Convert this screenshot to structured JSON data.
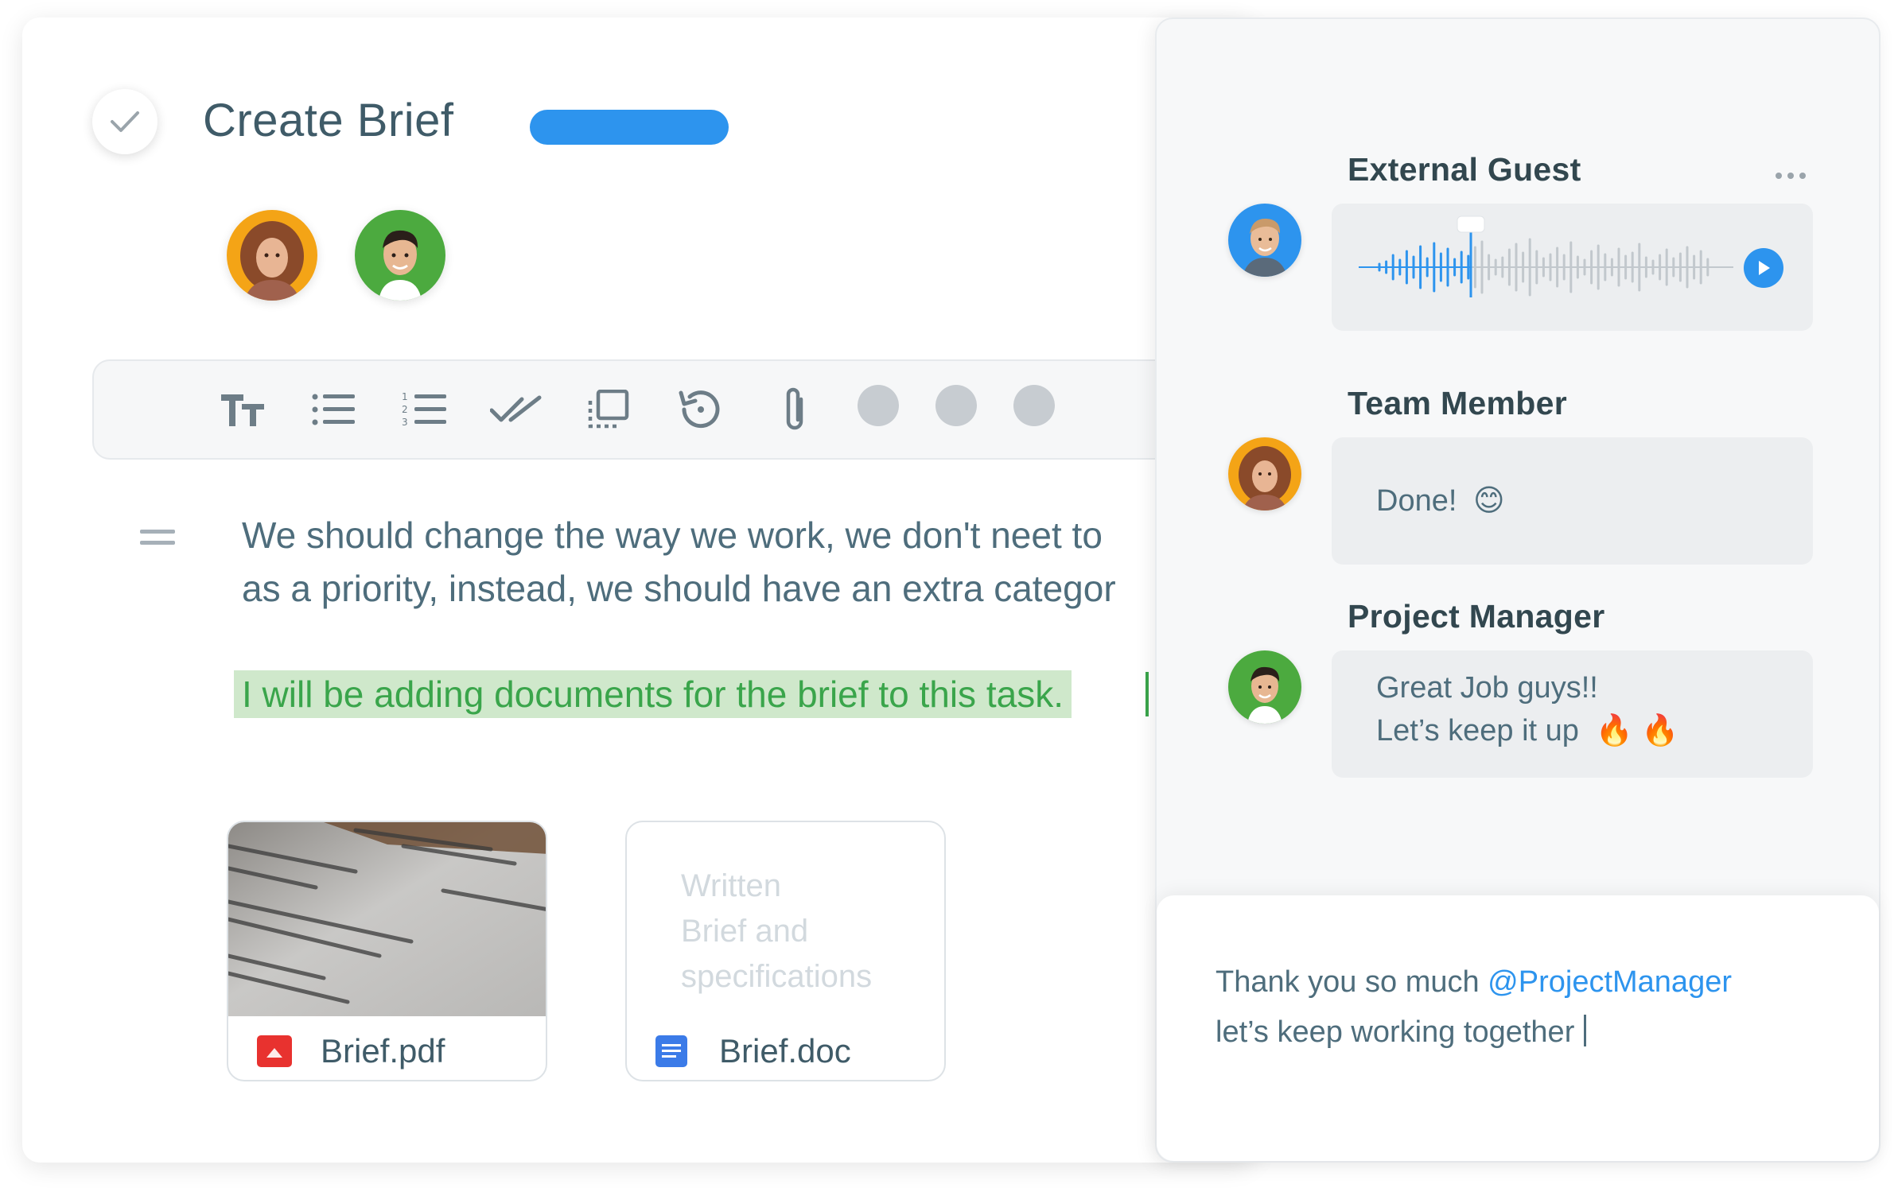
{
  "task": {
    "title": "Create Brief",
    "status_color": "#2d94ee",
    "assignees": [
      "curly-haired-woman-avatar",
      "young-man-avatar"
    ]
  },
  "toolbar": {
    "tools": [
      "text-size-icon",
      "bullet-list-icon",
      "numbered-list-icon",
      "checklist-icon",
      "select-area-icon",
      "history-icon",
      "attachment-icon",
      "more-dot",
      "more-dot",
      "more-dot"
    ]
  },
  "body": {
    "line1": "We should change the way we work, we don't neet to",
    "line2": "as a priority, instead, we should have an extra categor",
    "highlight": "I will be adding documents for the brief to this task."
  },
  "attachments": [
    {
      "name": "Brief.pdf",
      "icon": "pdf-file-icon",
      "icon_color": "#e8322f"
    },
    {
      "name": "Brief.doc",
      "icon": "doc-file-icon",
      "icon_color": "#3b7be8",
      "preview": [
        "Written",
        "Brief and",
        "specifications"
      ]
    }
  ],
  "chat": {
    "messages": [
      {
        "sender": "External Guest",
        "type": "voice-message"
      },
      {
        "sender": "Team Member",
        "text": "Done!",
        "emoji": "😊"
      },
      {
        "sender": "Project Manager",
        "line1": "Great Job guys!!",
        "line2": "Let’s keep it up",
        "emoji": "🔥 🔥"
      }
    ],
    "reply": {
      "prefix": "Thank you so much ",
      "mention": "@ProjectManager",
      "line2": "let’s keep working together"
    },
    "accent": "#2d94ee"
  }
}
